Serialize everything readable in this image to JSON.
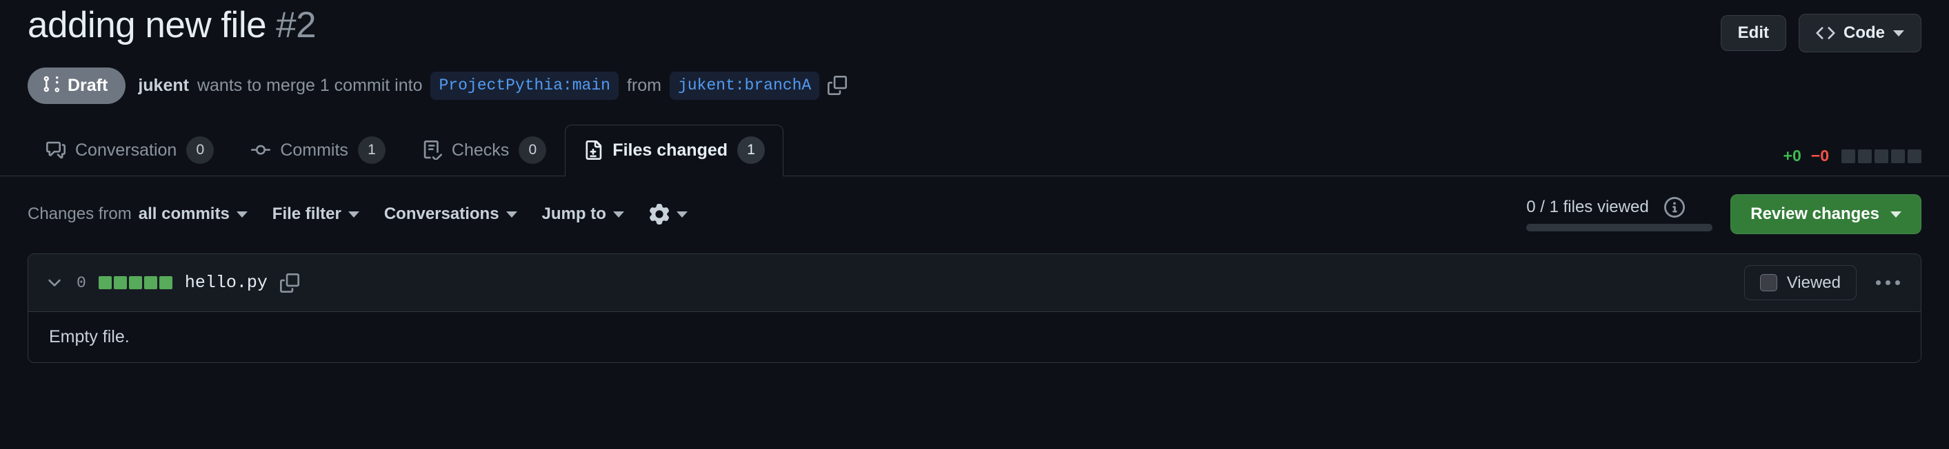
{
  "header": {
    "title": "adding new file",
    "number": "#2",
    "edit_label": "Edit",
    "code_label": "Code"
  },
  "subtitle": {
    "status_badge": "Draft",
    "author": "jukent",
    "action_text": "wants to merge 1 commit into",
    "base_branch": "ProjectPythia:main",
    "from_text": "from",
    "head_branch": "jukent:branchA"
  },
  "tabs": [
    {
      "label": "Conversation",
      "count": "0",
      "icon": "comment-discussion-icon",
      "active": false
    },
    {
      "label": "Commits",
      "count": "1",
      "icon": "git-commit-icon",
      "active": false
    },
    {
      "label": "Checks",
      "count": "0",
      "icon": "checklist-icon",
      "active": false
    },
    {
      "label": "Files changed",
      "count": "1",
      "icon": "file-diff-icon",
      "active": true
    }
  ],
  "diffstat": {
    "additions": "+0",
    "deletions": "−0",
    "blocks": 5
  },
  "toolbar": {
    "changes_from_prefix": "Changes from",
    "changes_from_value": "all commits",
    "file_filter": "File filter",
    "conversations": "Conversations",
    "jump_to": "Jump to",
    "settings_icon": "gear-icon",
    "files_viewed": "0 / 1 files viewed",
    "info_icon": "info-icon",
    "progress_percent": 0,
    "review_changes": "Review changes"
  },
  "file": {
    "collapse_icon": "chevron-down-icon",
    "change_count": "0",
    "diff_blocks": 5,
    "name": "hello.py",
    "copy_icon": "copy-icon",
    "viewed_label": "Viewed",
    "viewed_checked": false,
    "menu_icon": "kebab-horizontal-icon",
    "body_text": "Empty file."
  },
  "colors": {
    "background": "#0d1117",
    "accent_green": "#347d39",
    "diff_add": "#57ab5a",
    "additions_text": "#3fb950",
    "deletions_text": "#f85149",
    "link_blue": "#539bf5",
    "muted_text": "#8b949e",
    "border": "#30363d"
  }
}
